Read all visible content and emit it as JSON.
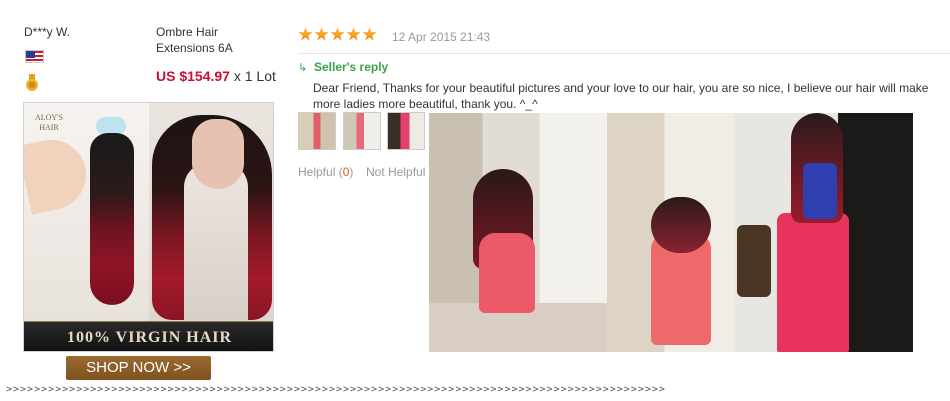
{
  "review": {
    "buyer_name": "D***y W.",
    "country_flag": "us-flag-icon",
    "buyer_level_badge": "medal-icon",
    "product_name": "Ombre Hair Extensions 6A",
    "price": "US $154.97",
    "quantity": "x 1 Lot",
    "rating_stars": 5,
    "date": "12 Apr 2015 21:43",
    "seller_reply_label": "Seller's reply",
    "seller_reply_text": "Dear Friend, Thanks for your beautiful pictures and your love to our hair, you are so nice, I believe our hair will make more ladies more beautiful, thank you. ^_^",
    "helpful_label": "Helpful (",
    "helpful_count": "0",
    "helpful_close": ")",
    "not_helpful_label": "Not Helpful"
  },
  "promo": {
    "logo_text": "ALOY'S HAIR",
    "banner_text": "100% VIRGIN HAIR",
    "shop_button": "SHOP NOW >>"
  },
  "colors": {
    "price_red": "#c8102e",
    "star_orange": "#f08a12",
    "reply_green": "#3aa34a",
    "helpful_count_orange": "#e2592b",
    "shop_button_brown": "#8a5c26"
  },
  "footer": {
    "divider": ">>>>>>>>>>>>>>>>>>>>>>>>>>>>>>>>>>>>>>>>>>>>>>>>>>>>>>>>>>>>>>>>>>>>>>>>>>>>>>>>>>>>>>>>>>>>>>"
  }
}
